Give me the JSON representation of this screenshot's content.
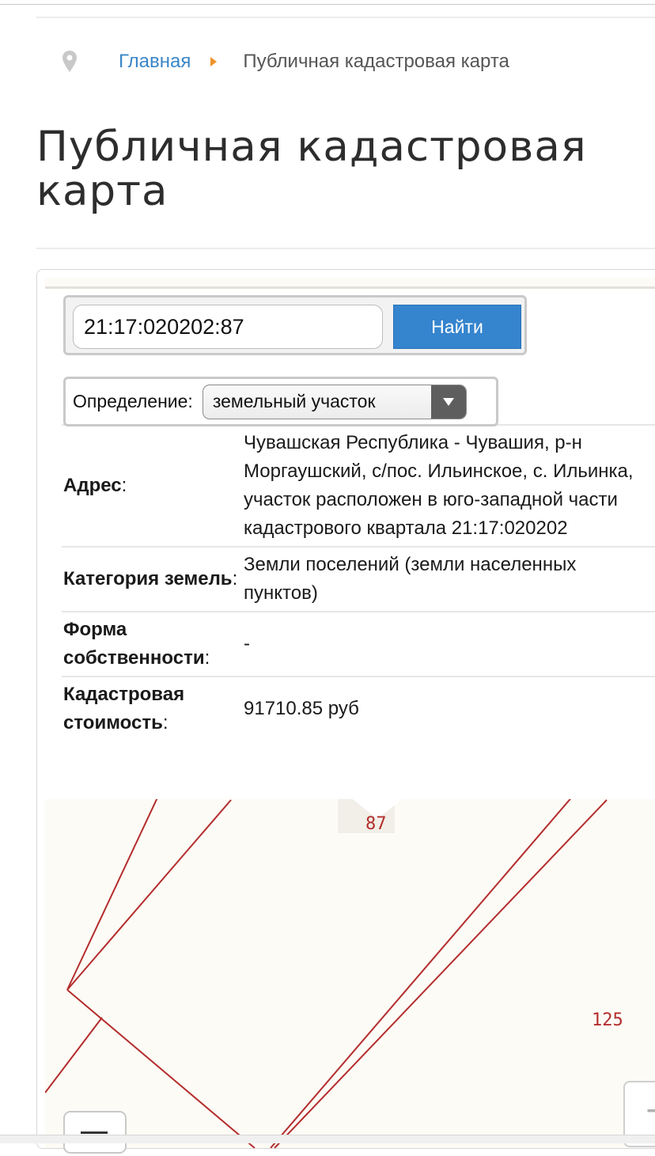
{
  "breadcrumb": {
    "icon": "map-pin-icon",
    "home_label": "Главная",
    "separator_icon": "caret-right-icon",
    "current_label": "Публичная кадастровая карта"
  },
  "page": {
    "title": "Публичная кадастровая карта"
  },
  "search": {
    "value": "21:17:020202:87",
    "button_label": "Найти"
  },
  "definition": {
    "label": "Определение:",
    "selected": "земельный участок",
    "arrow_icon": "dropdown-arrow-icon"
  },
  "info": [
    {
      "key": "Адрес",
      "value": "Чувашская Республика - Чувашия, р-н Моргаушский, с/пос. Ильинское, с. Ильинка, участок расположен в юго-западной части кадастрового квартала 21:17:020202"
    },
    {
      "key": "Категория земель",
      "value": "Земли поселений (земли населенных пунктов)"
    },
    {
      "key": "Форма собственности",
      "value": "-"
    },
    {
      "key": "Кадастровая стоимость",
      "value": "91710.85 руб"
    }
  ],
  "map": {
    "parcel_label": "87",
    "neighbor_label": "125",
    "line_color": "#b32d2d",
    "background": "#fdfbf5"
  },
  "controls": {
    "zoom_in_icon": "plus-icon",
    "layers_icon": "layers-icon"
  }
}
